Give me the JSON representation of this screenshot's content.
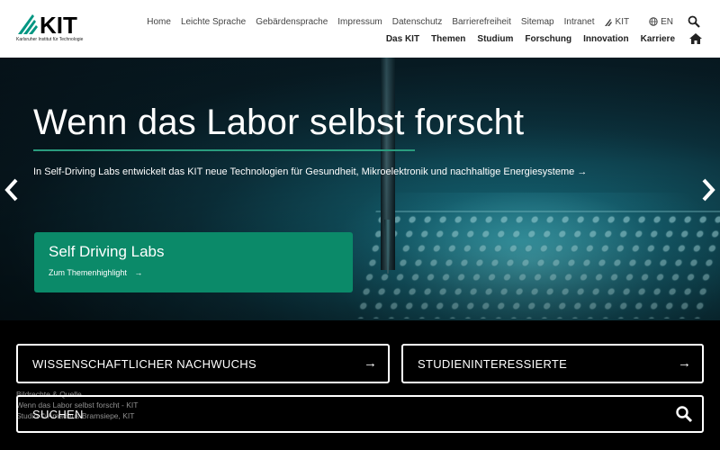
{
  "logo": {
    "text": "KIT",
    "subtitle": "Karlsruher Institut für Technologie"
  },
  "top_nav": [
    "Home",
    "Leichte Sprache",
    "Gebärdensprache",
    "Impressum",
    "Datenschutz",
    "Barrierefreiheit",
    "Sitemap",
    "Intranet"
  ],
  "kit_link": "KIT",
  "language": "EN",
  "main_nav": [
    "Das KIT",
    "Themen",
    "Studium",
    "Forschung",
    "Innovation",
    "Karriere"
  ],
  "hero": {
    "title": "Wenn das Labor selbst forscht",
    "subtitle": "In Self-Driving Labs entwickelt das KIT neue Technologien für Gesundheit, Mikroelektronik und nachhaltige Energiesysteme →",
    "card_title": "Self Driving Labs",
    "card_link": "Zum Themenhighlight"
  },
  "quick_links": {
    "left": "WISSENSCHAFTLICHER NACHWUCHS",
    "right": "STUDIENINTERESSIERTE",
    "search": "SUCHEN"
  },
  "caption": {
    "line1": "Bildrechte & Quelle",
    "line2": "Wenn das Labor selbst forscht - KIT",
    "line3": "Studio © Amadeus Bramsiepe, KIT"
  },
  "colors": {
    "accent_green": "#0b8a69",
    "underline_green": "#2a9c7e"
  },
  "icons": {
    "search": "search-icon",
    "home": "home-icon",
    "globe": "globe-icon",
    "prev": "chevron-left-icon",
    "next": "chevron-right-icon"
  }
}
